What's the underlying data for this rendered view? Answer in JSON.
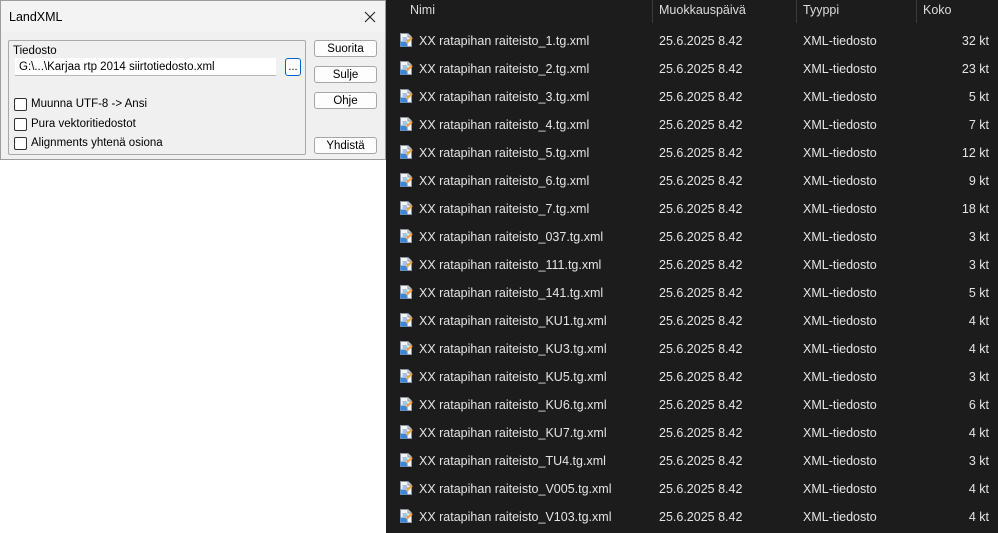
{
  "dialog": {
    "title": "LandXML",
    "group_label": "Tiedosto",
    "file_path": "G:\\...\\Karjaa rtp 2014 siirtotiedosto.xml",
    "browse_label": "...",
    "checkboxes": [
      {
        "label": "Muunna UTF-8 -> Ansi",
        "checked": false
      },
      {
        "label": "Pura vektoritiedostot",
        "checked": false
      },
      {
        "label": "Alignments yhtenä osiona",
        "checked": false
      }
    ],
    "buttons": {
      "run": "Suorita",
      "close": "Sulje",
      "help": "Ohje",
      "merge": "Yhdistä"
    },
    "icons": {
      "close": "close-icon"
    }
  },
  "explorer": {
    "columns": {
      "name": "Nimi",
      "modified": "Muokkauspäivä",
      "type": "Tyyppi",
      "size": "Koko"
    },
    "file_icon": "xml-file-icon",
    "colors": {
      "background": "#1c1c1c",
      "text": "#e4e4e4"
    },
    "files": [
      {
        "name": "XX ratapihan raiteisto_1.tg.xml",
        "modified": "25.6.2025 8.42",
        "type": "XML-tiedosto",
        "size": "32 kt"
      },
      {
        "name": "XX ratapihan raiteisto_2.tg.xml",
        "modified": "25.6.2025 8.42",
        "type": "XML-tiedosto",
        "size": "23 kt"
      },
      {
        "name": "XX ratapihan raiteisto_3.tg.xml",
        "modified": "25.6.2025 8.42",
        "type": "XML-tiedosto",
        "size": "5 kt"
      },
      {
        "name": "XX ratapihan raiteisto_4.tg.xml",
        "modified": "25.6.2025 8.42",
        "type": "XML-tiedosto",
        "size": "7 kt"
      },
      {
        "name": "XX ratapihan raiteisto_5.tg.xml",
        "modified": "25.6.2025 8.42",
        "type": "XML-tiedosto",
        "size": "12 kt"
      },
      {
        "name": "XX ratapihan raiteisto_6.tg.xml",
        "modified": "25.6.2025 8.42",
        "type": "XML-tiedosto",
        "size": "9 kt"
      },
      {
        "name": "XX ratapihan raiteisto_7.tg.xml",
        "modified": "25.6.2025 8.42",
        "type": "XML-tiedosto",
        "size": "18 kt"
      },
      {
        "name": "XX ratapihan raiteisto_037.tg.xml",
        "modified": "25.6.2025 8.42",
        "type": "XML-tiedosto",
        "size": "3 kt"
      },
      {
        "name": "XX ratapihan raiteisto_111.tg.xml",
        "modified": "25.6.2025 8.42",
        "type": "XML-tiedosto",
        "size": "3 kt"
      },
      {
        "name": "XX ratapihan raiteisto_141.tg.xml",
        "modified": "25.6.2025 8.42",
        "type": "XML-tiedosto",
        "size": "5 kt"
      },
      {
        "name": "XX ratapihan raiteisto_KU1.tg.xml",
        "modified": "25.6.2025 8.42",
        "type": "XML-tiedosto",
        "size": "4 kt"
      },
      {
        "name": "XX ratapihan raiteisto_KU3.tg.xml",
        "modified": "25.6.2025 8.42",
        "type": "XML-tiedosto",
        "size": "4 kt"
      },
      {
        "name": "XX ratapihan raiteisto_KU5.tg.xml",
        "modified": "25.6.2025 8.42",
        "type": "XML-tiedosto",
        "size": "3 kt"
      },
      {
        "name": "XX ratapihan raiteisto_KU6.tg.xml",
        "modified": "25.6.2025 8.42",
        "type": "XML-tiedosto",
        "size": "6 kt"
      },
      {
        "name": "XX ratapihan raiteisto_KU7.tg.xml",
        "modified": "25.6.2025 8.42",
        "type": "XML-tiedosto",
        "size": "4 kt"
      },
      {
        "name": "XX ratapihan raiteisto_TU4.tg.xml",
        "modified": "25.6.2025 8.42",
        "type": "XML-tiedosto",
        "size": "3 kt"
      },
      {
        "name": "XX ratapihan raiteisto_V005.tg.xml",
        "modified": "25.6.2025 8.42",
        "type": "XML-tiedosto",
        "size": "4 kt"
      },
      {
        "name": "XX ratapihan raiteisto_V103.tg.xml",
        "modified": "25.6.2025 8.42",
        "type": "XML-tiedosto",
        "size": "4 kt"
      }
    ]
  }
}
